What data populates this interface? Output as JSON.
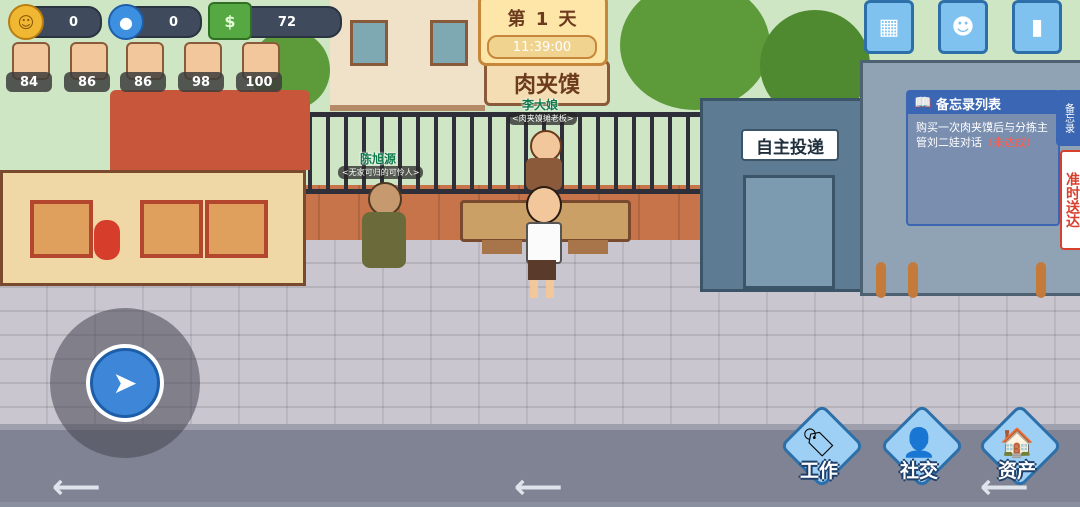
{
  "hud": {
    "coins": "0",
    "followers": "0",
    "cash": "72",
    "icons": {
      "coins": "coin-icon",
      "followers": "user-icon",
      "cash": "cash-icon"
    }
  },
  "stats": [
    {
      "value": "84",
      "icon": "portrait-icon"
    },
    {
      "value": "86",
      "icon": "portrait-icon"
    },
    {
      "value": "86",
      "icon": "portrait-icon"
    },
    {
      "value": "98",
      "icon": "portrait-icon"
    },
    {
      "value": "100",
      "icon": "portrait-icon"
    }
  ],
  "day_card": {
    "day": "第 1 天",
    "time": "11:39:00"
  },
  "top_buttons": [
    "map-icon",
    "profile-icon",
    "ranking-icon"
  ],
  "scene": {
    "stall_sign": "肉夹馍",
    "booth_label": "自主投递",
    "npcs": [
      {
        "name": "李大娘",
        "title": "<肉夹馍摊老板>"
      },
      {
        "name": "陈旭源",
        "title": "<无家可归的可怜人>"
      }
    ]
  },
  "memo": {
    "header": "备忘录列表",
    "task": "购买一次肉夹馍后与分拣主管刘二娃对话",
    "status": "（未达成）",
    "tab": "备忘录",
    "side_banner": "准时送达"
  },
  "bottom_nav": [
    {
      "label": "工作",
      "icon": "work-icon"
    },
    {
      "label": "社交",
      "icon": "social-icon"
    },
    {
      "label": "资产",
      "icon": "assets-icon"
    }
  ],
  "colors": {
    "accent": "#3a66b4",
    "pending": "#ff5b4a",
    "npc_name": "#0e7a4a"
  }
}
